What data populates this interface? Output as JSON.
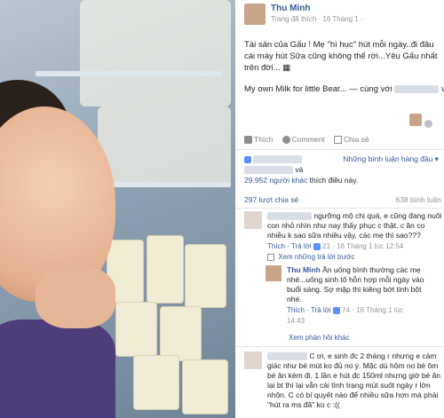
{
  "post": {
    "author": "Thu Minh",
    "meta": "Trang đã thích · 16 Tháng 1 ·",
    "text": "Tài sản của Gấu ! Mẹ \"hì hục\" hút mỗi ngày..đi đâu cái máy hút Sữa cũng không thể rời...Yêu Gấu nhất trên đời...",
    "caption": "My own Milk for little Bear... — cùng với",
    "caption_end": "và",
    "actions": {
      "like": "Thích",
      "comment": "Comment",
      "share": "Chia sẻ"
    },
    "sort_label": "Những bình luận hàng đầu ▾",
    "likes_and": "và",
    "likes_count": "29.952 người khác",
    "likes_suffix": "thích điều này.",
    "shares": "297 lượt chia sẻ",
    "comments_count": "638 bình luận"
  },
  "comments": [
    {
      "text": "ngưỡng mộ chị quá, e cũng đang nuôi con nhỏ nhìn như nay thấy phục c thật, c ăn co nhiều k sao sữa nhiều vậy, các mẹ thì sao???",
      "reply": "Thích · Trả lời",
      "likes": "21",
      "date": "· 16 Tháng 1 lúc 12:54",
      "prev_replies": "Xem những trả lời trước"
    },
    {
      "author": "Thu Minh",
      "text": "Ăn uống bình thường các mẹ nhé...uống sinh tố hỗn hợp mỗi ngày vào buổi sáng. Sợ mập thì kiêng bớt tinh bột nhé.",
      "reply": "Thích · Trả lời",
      "likes": "74",
      "date": "· 16 Tháng 1 lúc",
      "time": "14:43",
      "more_replies": "Xem phản hồi khác"
    },
    {
      "text": "C ơi, e sinh đc 2 tháng r nhưng e cảm giác như bé mút ko đủ no ý. Mặc dù hôm no bé ôm bé ăn kém đi, 1 lần e hút đc 150ml nhưng giờ bé ăn lại bt thì lại vẫn cái tình trạng mút suốt ngày r lớn nhôn. C có bí quyết nào để nhiều sữa hơn mà phải \"hút ra ms đã\" ko c :(("
    }
  ]
}
